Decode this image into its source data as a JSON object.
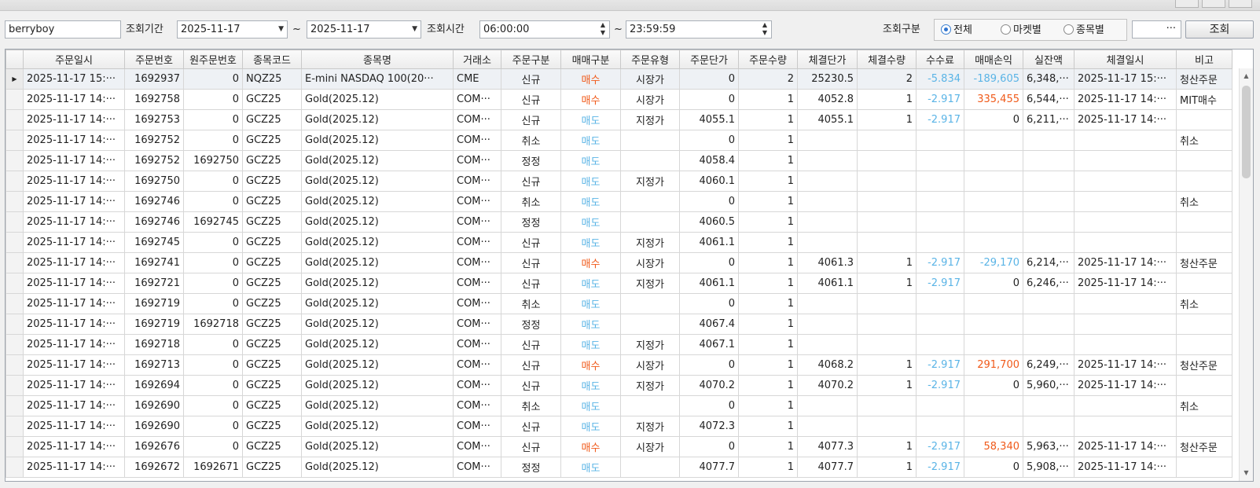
{
  "toolbar": {
    "user_id": "berryboy",
    "period_label": "조회기간",
    "date_from": "2025-11-17",
    "tilde": "~",
    "date_to": "2025-11-17",
    "time_label": "조회시간",
    "time_from": "06:00:00",
    "time_to": "23:59:59",
    "filter_label": "조회구분",
    "radio_options": [
      "전체",
      "마켓별",
      "종목별"
    ],
    "radio_selected": "전체",
    "more_box": "···",
    "query_button": "조회"
  },
  "colors": {
    "buy": "#f05a1a",
    "sell": "#5ab4e6",
    "loss": "#5ab4e6",
    "profit": "#f05a1a"
  },
  "table": {
    "columns": [
      "주문일시",
      "주문번호",
      "원주문번호",
      "종목코드",
      "종목명",
      "거래소",
      "주문구분",
      "매매구분",
      "주문유형",
      "주문단가",
      "주문수량",
      "체결단가",
      "체결수량",
      "수수료",
      "매매손익",
      "실잔액",
      "체결일시",
      "비고"
    ],
    "rows": [
      [
        "2025-11-17 15:···",
        "1692937",
        "0",
        "NQZ25",
        "E-mini NASDAQ 100(20···",
        "CME",
        "신규",
        "매수",
        "시장가",
        "0",
        "2",
        "25230.5",
        "2",
        "-5.834",
        "-189,605",
        "6,348,···",
        "2025-11-17 15:···",
        "청산주문"
      ],
      [
        "2025-11-17 14:···",
        "1692758",
        "0",
        "GCZ25",
        "Gold(2025.12)",
        "COM···",
        "신규",
        "매수",
        "시장가",
        "0",
        "1",
        "4052.8",
        "1",
        "-2.917",
        "335,455",
        "6,544,···",
        "2025-11-17 14:···",
        "MIT매수"
      ],
      [
        "2025-11-17 14:···",
        "1692753",
        "0",
        "GCZ25",
        "Gold(2025.12)",
        "COM···",
        "신규",
        "매도",
        "지정가",
        "4055.1",
        "1",
        "4055.1",
        "1",
        "-2.917",
        "0",
        "6,211,···",
        "2025-11-17 14:···",
        ""
      ],
      [
        "2025-11-17 14:···",
        "1692752",
        "0",
        "GCZ25",
        "Gold(2025.12)",
        "COM···",
        "취소",
        "매도",
        "",
        "0",
        "1",
        "",
        "",
        "",
        "",
        "",
        "",
        "취소"
      ],
      [
        "2025-11-17 14:···",
        "1692752",
        "1692750",
        "GCZ25",
        "Gold(2025.12)",
        "COM···",
        "정정",
        "매도",
        "",
        "4058.4",
        "1",
        "",
        "",
        "",
        "",
        "",
        "",
        ""
      ],
      [
        "2025-11-17 14:···",
        "1692750",
        "0",
        "GCZ25",
        "Gold(2025.12)",
        "COM···",
        "신규",
        "매도",
        "지정가",
        "4060.1",
        "1",
        "",
        "",
        "",
        "",
        "",
        "",
        ""
      ],
      [
        "2025-11-17 14:···",
        "1692746",
        "0",
        "GCZ25",
        "Gold(2025.12)",
        "COM···",
        "취소",
        "매도",
        "",
        "0",
        "1",
        "",
        "",
        "",
        "",
        "",
        "",
        "취소"
      ],
      [
        "2025-11-17 14:···",
        "1692746",
        "1692745",
        "GCZ25",
        "Gold(2025.12)",
        "COM···",
        "정정",
        "매도",
        "",
        "4060.5",
        "1",
        "",
        "",
        "",
        "",
        "",
        "",
        ""
      ],
      [
        "2025-11-17 14:···",
        "1692745",
        "0",
        "GCZ25",
        "Gold(2025.12)",
        "COM···",
        "신규",
        "매도",
        "지정가",
        "4061.1",
        "1",
        "",
        "",
        "",
        "",
        "",
        "",
        ""
      ],
      [
        "2025-11-17 14:···",
        "1692741",
        "0",
        "GCZ25",
        "Gold(2025.12)",
        "COM···",
        "신규",
        "매수",
        "시장가",
        "0",
        "1",
        "4061.3",
        "1",
        "-2.917",
        "-29,170",
        "6,214,···",
        "2025-11-17 14:···",
        "청산주문"
      ],
      [
        "2025-11-17 14:···",
        "1692721",
        "0",
        "GCZ25",
        "Gold(2025.12)",
        "COM···",
        "신규",
        "매도",
        "지정가",
        "4061.1",
        "1",
        "4061.1",
        "1",
        "-2.917",
        "0",
        "6,246,···",
        "2025-11-17 14:···",
        ""
      ],
      [
        "2025-11-17 14:···",
        "1692719",
        "0",
        "GCZ25",
        "Gold(2025.12)",
        "COM···",
        "취소",
        "매도",
        "",
        "0",
        "1",
        "",
        "",
        "",
        "",
        "",
        "",
        "취소"
      ],
      [
        "2025-11-17 14:···",
        "1692719",
        "1692718",
        "GCZ25",
        "Gold(2025.12)",
        "COM···",
        "정정",
        "매도",
        "",
        "4067.4",
        "1",
        "",
        "",
        "",
        "",
        "",
        "",
        ""
      ],
      [
        "2025-11-17 14:···",
        "1692718",
        "0",
        "GCZ25",
        "Gold(2025.12)",
        "COM···",
        "신규",
        "매도",
        "지정가",
        "4067.1",
        "1",
        "",
        "",
        "",
        "",
        "",
        "",
        ""
      ],
      [
        "2025-11-17 14:···",
        "1692713",
        "0",
        "GCZ25",
        "Gold(2025.12)",
        "COM···",
        "신규",
        "매수",
        "시장가",
        "0",
        "1",
        "4068.2",
        "1",
        "-2.917",
        "291,700",
        "6,249,···",
        "2025-11-17 14:···",
        "청산주문"
      ],
      [
        "2025-11-17 14:···",
        "1692694",
        "0",
        "GCZ25",
        "Gold(2025.12)",
        "COM···",
        "신규",
        "매도",
        "지정가",
        "4070.2",
        "1",
        "4070.2",
        "1",
        "-2.917",
        "0",
        "5,960,···",
        "2025-11-17 14:···",
        ""
      ],
      [
        "2025-11-17 14:···",
        "1692690",
        "0",
        "GCZ25",
        "Gold(2025.12)",
        "COM···",
        "취소",
        "매도",
        "",
        "0",
        "1",
        "",
        "",
        "",
        "",
        "",
        "",
        "취소"
      ],
      [
        "2025-11-17 14:···",
        "1692690",
        "0",
        "GCZ25",
        "Gold(2025.12)",
        "COM···",
        "신규",
        "매도",
        "지정가",
        "4072.3",
        "1",
        "",
        "",
        "",
        "",
        "",
        "",
        ""
      ],
      [
        "2025-11-17 14:···",
        "1692676",
        "0",
        "GCZ25",
        "Gold(2025.12)",
        "COM···",
        "신규",
        "매수",
        "시장가",
        "0",
        "1",
        "4077.3",
        "1",
        "-2.917",
        "58,340",
        "5,963,···",
        "2025-11-17 14:···",
        "청산주문"
      ],
      [
        "2025-11-17 14:···",
        "1692672",
        "1692671",
        "GCZ25",
        "Gold(2025.12)",
        "COM···",
        "정정",
        "매도",
        "",
        "4077.7",
        "1",
        "4077.7",
        "1",
        "-2.917",
        "0",
        "5,908,···",
        "2025-11-17 14:···",
        ""
      ]
    ]
  }
}
